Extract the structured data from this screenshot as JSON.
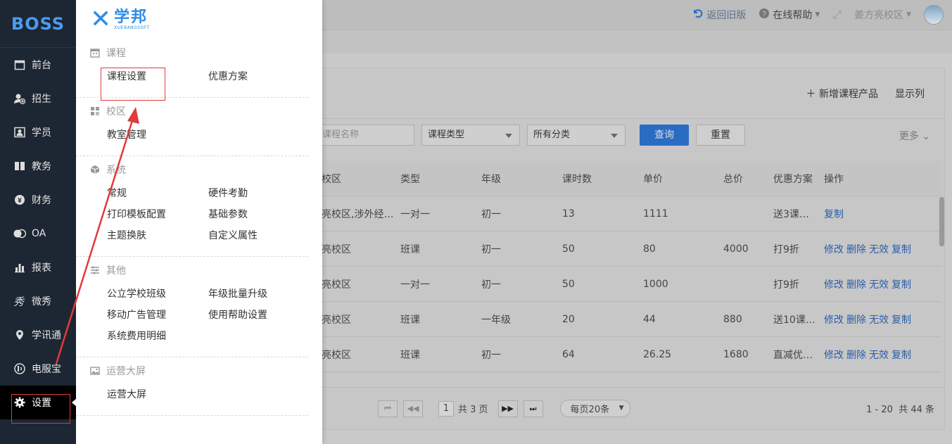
{
  "sidebar": {
    "logo": "BOSS",
    "items": [
      {
        "label": "前台",
        "icon": "calendar-icon"
      },
      {
        "label": "招生",
        "icon": "user-plus-icon"
      },
      {
        "label": "学员",
        "icon": "id-card-icon"
      },
      {
        "label": "教务",
        "icon": "book-icon"
      },
      {
        "label": "财务",
        "icon": "yen-icon"
      },
      {
        "label": "OA",
        "icon": "oa-icon"
      },
      {
        "label": "报表",
        "icon": "bar-chart-icon"
      },
      {
        "label": "微秀",
        "icon": "xiu-icon"
      },
      {
        "label": "学讯通",
        "icon": "location-icon"
      },
      {
        "label": "电服宝",
        "icon": "phone-icon"
      },
      {
        "label": "设置",
        "icon": "gear-icon"
      }
    ]
  },
  "topbar": {
    "back_old": "返回旧版",
    "help": "在线帮助",
    "campus": "姜方亮校区"
  },
  "menu": {
    "brand_cn": "学邦",
    "brand_en": "XUEBANGSOFT",
    "sections": [
      {
        "title": "课程",
        "icon": "calendar-icon",
        "items": [
          "课程设置",
          "优惠方案"
        ]
      },
      {
        "title": "校区",
        "icon": "grid-icon",
        "items": [
          "教室管理"
        ]
      },
      {
        "title": "系统",
        "icon": "cube-icon",
        "items": [
          "常规",
          "硬件考勤",
          "打印模板配置",
          "基础参数",
          "主题换肤",
          "自定义属性"
        ]
      },
      {
        "title": "其他",
        "icon": "sliders-icon",
        "items": [
          "公立学校班级",
          "年级批量升级",
          "移动广告管理",
          "使用帮助设置",
          "系统费用明细"
        ]
      },
      {
        "title": "运营大屏",
        "icon": "image-icon",
        "items": [
          "运营大屏"
        ]
      }
    ]
  },
  "card": {
    "add_product": "新增课程产品",
    "show_columns": "显示列",
    "search_placeholder": "课程名称",
    "type_select": "课程类型",
    "category_select": "所有分类",
    "query": "查询",
    "reset": "重置",
    "more": "更多"
  },
  "table": {
    "headers": [
      "校区",
      "类型",
      "年级",
      "课时数",
      "单价",
      "总价",
      "优惠方案",
      "操作"
    ],
    "rows": [
      {
        "campus": "亮校区,涉外经…",
        "type": "一对一",
        "grade": "初一",
        "hours": "13",
        "unit": "1111",
        "total": "",
        "promo": "送3课…",
        "ops": [
          "复制"
        ]
      },
      {
        "campus": "亮校区",
        "type": "班课",
        "grade": "初一",
        "hours": "50",
        "unit": "80",
        "total": "4000",
        "promo": "打9折",
        "ops": [
          "修改",
          "删除",
          "无效",
          "复制"
        ]
      },
      {
        "campus": "亮校区",
        "type": "一对一",
        "grade": "初一",
        "hours": "50",
        "unit": "1000",
        "total": "",
        "promo": "打9折",
        "ops": [
          "修改",
          "删除",
          "无效",
          "复制"
        ]
      },
      {
        "campus": "亮校区",
        "type": "班课",
        "grade": "一年级",
        "hours": "20",
        "unit": "44",
        "total": "880",
        "promo": "送10课…",
        "ops": [
          "修改",
          "删除",
          "无效",
          "复制"
        ]
      },
      {
        "campus": "亮校区",
        "type": "班课",
        "grade": "初一",
        "hours": "64",
        "unit": "26.25",
        "total": "1680",
        "promo": "直减优…",
        "ops": [
          "修改",
          "删除",
          "无效",
          "复制"
        ]
      }
    ]
  },
  "pager": {
    "page": "1",
    "total_pages": "共 3 页",
    "page_size": "每页20条",
    "range": "1 - 20",
    "total": "共 44 条"
  },
  "colors": {
    "sidebar_bg": "#1d2633",
    "brand_blue": "#2f8ce8",
    "highlight_red": "#e03a3a"
  }
}
